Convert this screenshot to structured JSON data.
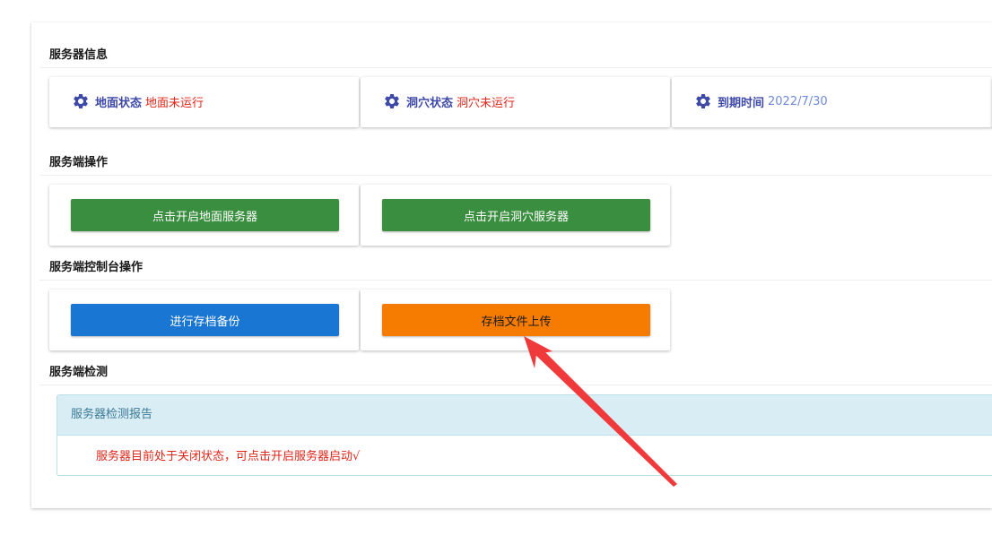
{
  "sections": {
    "server_info": "服务器信息",
    "server_ops": "服务端操作",
    "console_ops": "服务端控制台操作",
    "server_check": "服务端检测"
  },
  "info_cards": [
    {
      "label": "地面状态",
      "value": "地面未运行",
      "icon": "gear-icon"
    },
    {
      "label": "洞穴状态",
      "value": "洞穴未运行",
      "icon": "gear-icon"
    },
    {
      "label": "到期时间",
      "value": "2022/7/30",
      "icon": "gear-icon"
    }
  ],
  "buttons": {
    "start_overworld": "点击开启地面服务器",
    "start_caves": "点击开启洞穴服务器",
    "backup": "进行存档备份",
    "upload": "存档文件上传"
  },
  "report": {
    "title": "服务器检测报告",
    "message": "服务器目前处于关闭状态，可点击开启服务器启动√"
  },
  "colors": {
    "icon_accent": "#3f4aa8",
    "status_red": "#e0261a",
    "date_blue": "#6f8ad6",
    "green_button": "#3a8e3f",
    "blue_button": "#1976d2",
    "orange_button": "#f57c00",
    "annotation_arrow": "#f0393a"
  }
}
